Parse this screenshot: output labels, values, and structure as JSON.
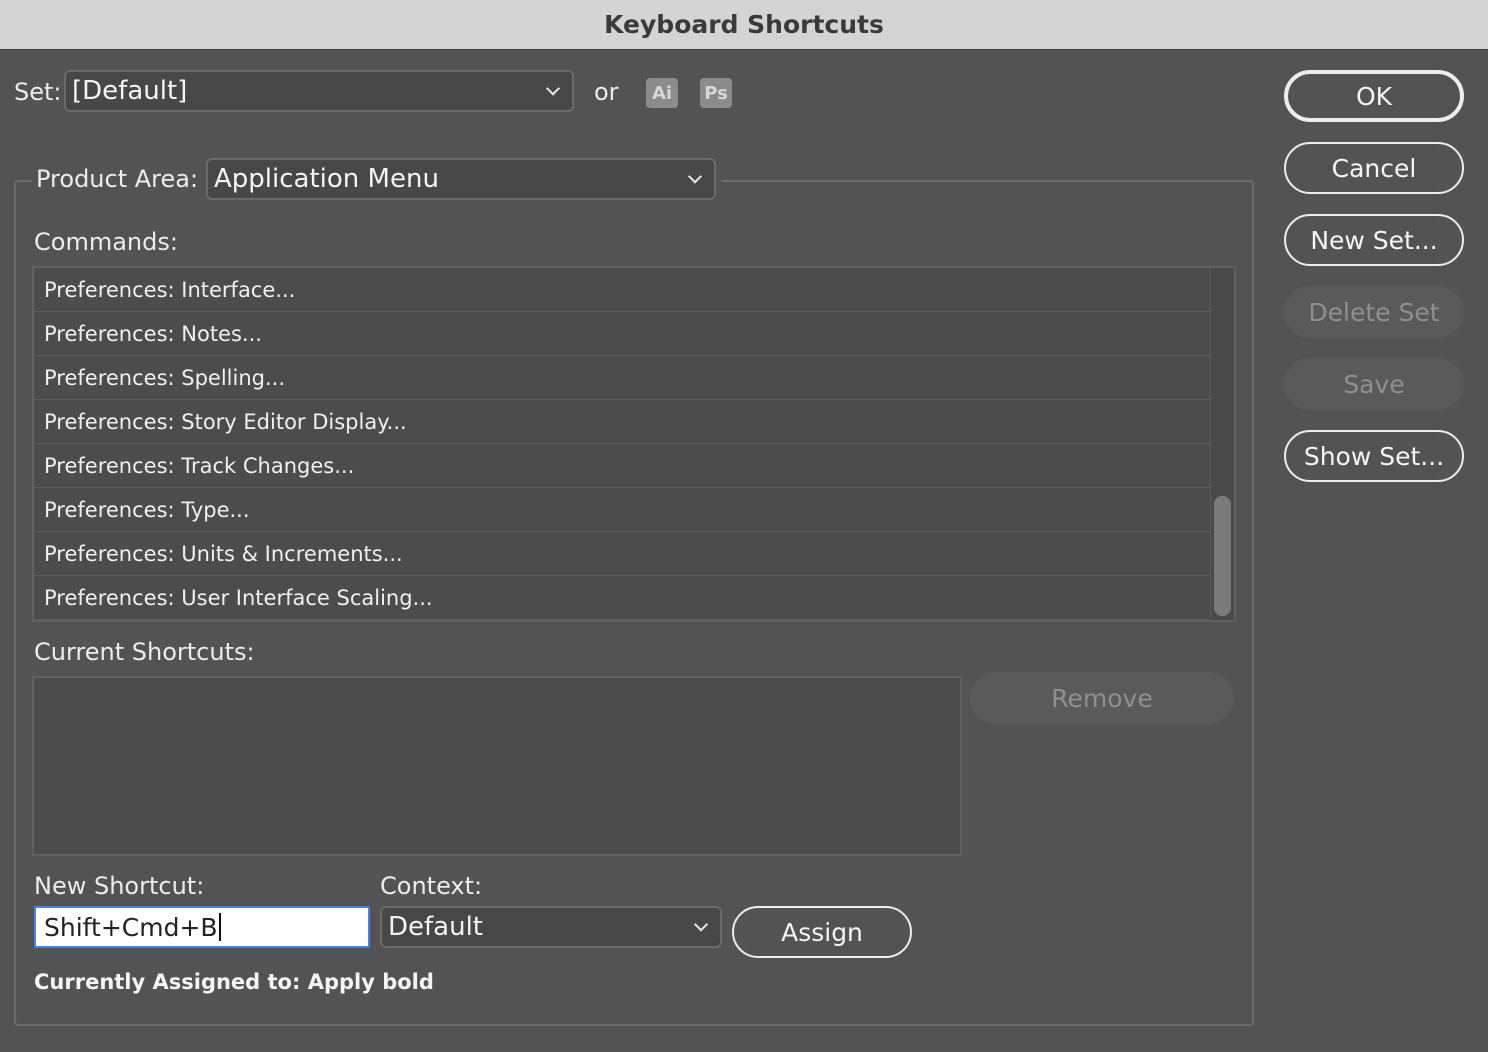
{
  "window": {
    "title": "Keyboard Shortcuts"
  },
  "set": {
    "label": "Set:",
    "value": "[Default]",
    "or_label": "or",
    "app_icons": [
      "Ai",
      "Ps"
    ]
  },
  "product_area": {
    "label": "Product Area:",
    "value": "Application Menu"
  },
  "commands": {
    "label": "Commands:",
    "items": [
      "Preferences: Interface...",
      "Preferences: Notes...",
      "Preferences: Spelling...",
      "Preferences: Story Editor Display...",
      "Preferences: Track Changes...",
      "Preferences: Type...",
      "Preferences: Units & Increments...",
      "Preferences: User Interface Scaling..."
    ]
  },
  "current_shortcuts": {
    "label": "Current Shortcuts:",
    "remove_label": "Remove"
  },
  "new_shortcut": {
    "label": "New Shortcut:",
    "value": "Shift+Cmd+B"
  },
  "context": {
    "label": "Context:",
    "value": "Default"
  },
  "assign_label": "Assign",
  "assigned_text": "Currently Assigned to: Apply bold",
  "buttons": {
    "ok": "OK",
    "cancel": "Cancel",
    "new_set": "New Set...",
    "delete_set": "Delete Set",
    "save": "Save",
    "show_set": "Show Set..."
  }
}
